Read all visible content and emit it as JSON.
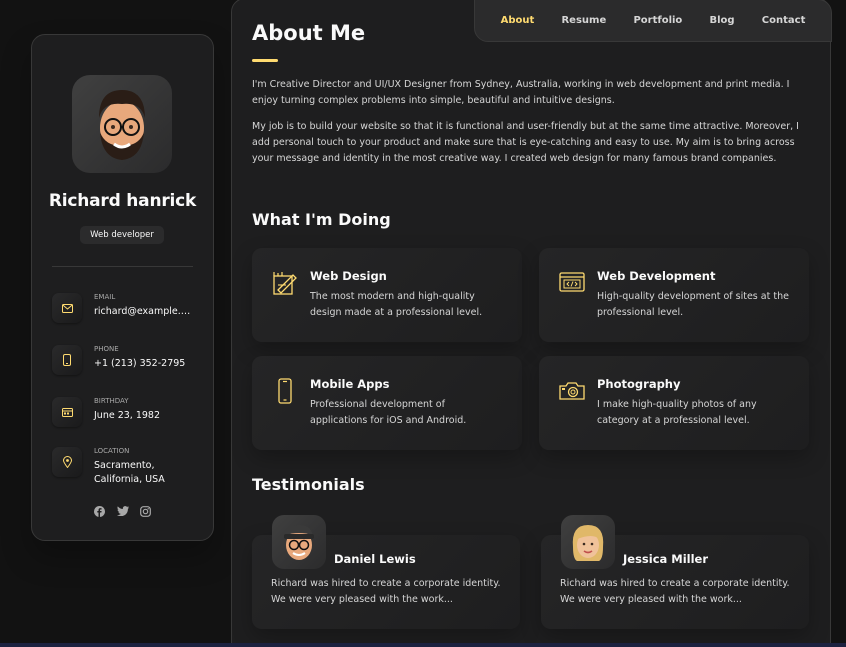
{
  "colors": {
    "accent": "#ffdb70",
    "bg": "#121212",
    "card": "#1e1e1f"
  },
  "profile": {
    "name": "Richard hanrick",
    "title": "Web developer",
    "avatar_icon": "memoji-avatar-icon"
  },
  "contacts": [
    {
      "icon": "mail-icon",
      "label": "Email",
      "value": "richard@example.c..."
    },
    {
      "icon": "phone-icon",
      "label": "Phone",
      "value": "+1 (213) 352-2795"
    },
    {
      "icon": "calendar-icon",
      "label": "Birthday",
      "value": "June 23, 1982"
    },
    {
      "icon": "location-icon",
      "label": "Location",
      "value": "Sacramento, California, USA"
    }
  ],
  "socials": [
    "facebook-icon",
    "twitter-icon",
    "instagram-icon"
  ],
  "nav": [
    {
      "label": "About",
      "active": true
    },
    {
      "label": "Resume"
    },
    {
      "label": "Portfolio"
    },
    {
      "label": "Blog"
    },
    {
      "label": "Contact"
    }
  ],
  "about": {
    "title": "About Me",
    "paragraphs": [
      "I'm Creative Director and UI/UX Designer from Sydney, Australia, working in web development and print media. I enjoy turning complex problems into simple, beautiful and intuitive designs.",
      "My job is to build your website so that it is functional and user-friendly but at the same time attractive. Moreover, I add personal touch to your product and make sure that is eye-catching and easy to use. My aim is to bring across your message and identity in the most creative way. I created web design for many famous brand companies."
    ]
  },
  "services": {
    "heading": "What I'm Doing",
    "items": [
      {
        "icon": "design-icon",
        "title": "Web Design",
        "desc": "The most modern and high-quality design made at a professional level."
      },
      {
        "icon": "code-icon",
        "title": "Web Development",
        "desc": "High-quality development of sites at the professional level."
      },
      {
        "icon": "mobile-icon",
        "title": "Mobile Apps",
        "desc": "Professional development of applications for iOS and Android."
      },
      {
        "icon": "camera-icon",
        "title": "Photography",
        "desc": "I make high-quality photos of any category at a professional level."
      }
    ]
  },
  "testimonials": {
    "heading": "Testimonials",
    "items": [
      {
        "name": "Daniel Lewis",
        "text": "Richard was hired to create a corporate identity. We were very pleased with the work..."
      },
      {
        "name": "Jessica Miller",
        "text": "Richard was hired to create a corporate identity. We were very pleased with the work..."
      }
    ]
  }
}
